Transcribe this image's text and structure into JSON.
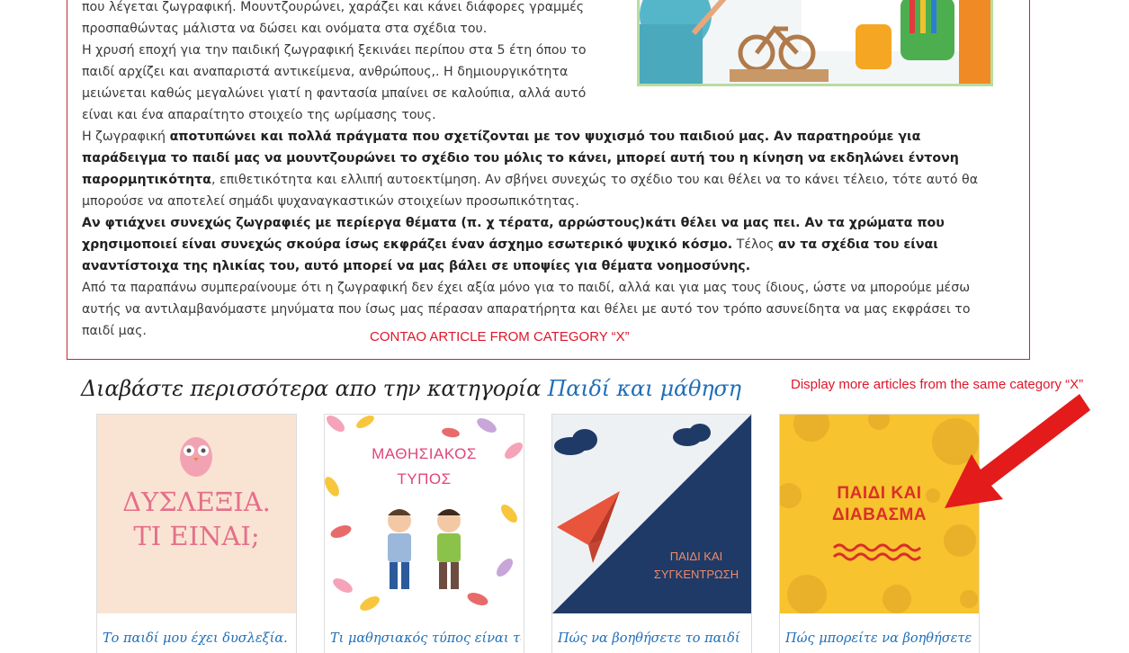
{
  "article": {
    "lines": [
      "που λέγεται ζωγραφική. Μουντζουρώνει, χαράζει και κάνει διάφορες γραμμές",
      "προσπαθώντας μάλιστα να δώσει και ονόματα στα σχέδια του.",
      "Η χρυσή εποχή για την παιδική ζωγραφική ξεκινάει περίπου στα 5 έτη όπου το",
      "παιδί αρχίζει και αναπαριστά αντικείμενα,  ανθρώπους,. Η δημιουργικότητα",
      "μειώνεται καθώς μεγαλώνει γιατί η φαντασία μπαίνει σε καλούπια, αλλά αυτό",
      "είναι και ένα απαραίτητο στοιχείο της ωρίμασης τους."
    ],
    "p2_a": "Η ζωγραφική ",
    "p2_b": "αποτυπώνει και πολλά πράγματα που σχετίζονται με τον ψυχισμό του παιδιού μας.  Αν παρατηρούμε για",
    "p2_c": "παράδειγμα το παιδί μας να μουντζουρώνει το σχέδιο του μόλις το κάνει, μπορεί αυτή του η κίνηση να εκδηλώνει έντονη",
    "p2_d": "παρορμητικότητα",
    "p2_e": ", επιθετικότητα και ελλιπή αυτοεκτίμηση. Αν σβήνει συνεχώς το σχέδιο του και θέλει να το κάνει τέλειο, τότε αυτό θα",
    "p2_f": "μπορούσε να αποτελεί σημάδι ψυχαναγκαστικών στοιχείων προσωπικότητας.",
    "p3_a": "Αν φτιάχνει συνεχώς ζωγραφιές με περίεργα θέματα (π. χ τέρατα, αρρώστους)κάτι θέλει να μας πει. Αν τα χρώματα που",
    "p3_b": "χρησιμοποιεί είναι συνεχώς σκούρα ίσως εκφράζει έναν άσχημο εσωτερικό ψυχικό κόσμο.",
    "p3_c": " Τέλος ",
    "p3_d": "αν τα σχέδια του είναι",
    "p3_e": "αναντίστοιχα της ηλικίας του, αυτό μπορεί να μας βάλει σε υποψίες για θέματα νοημοσύνης.",
    "p4_a": "Από τα παραπάνω συμπεραίνουμε ότι η ζωγραφική δεν έχει αξία μόνο για το παιδί, αλλά και για μας τους ίδιους, ώστε να μπορούμε μέσω",
    "p4_b": "αυτής να αντιλαμβανόμαστε  μηνύματα που ίσως μας πέρασαν απαρατήρητα και θέλει με αυτό τον τρόπο ασυνείδητα να μας εκφράσει το",
    "p4_c": "παιδί  μας."
  },
  "annotations": {
    "article": "CONTAO ARTICLE FROM CATEGORY “X”",
    "more": "Display more articles from the same category “X”"
  },
  "related": {
    "heading_prefix": "Διαβάστε περισσότερα απο την κατηγορία ",
    "category": "Παιδί και μάθηση",
    "cards": [
      {
        "title": "Το παιδί μου έχει δυσλεξία.",
        "thumb_line1": "ΔΥΣΛΕΞΙΑ.",
        "thumb_line2": "ΤΙ ΕΙΝΑΙ;"
      },
      {
        "title": "Τι μαθησιακός τύπος είναι το",
        "thumb_line1": "ΜΑΘΗΣΙΑΚΟΣ",
        "thumb_line2": "ΤΥΠΟΣ"
      },
      {
        "title": "Πώς να βοηθήσετε το παιδί",
        "thumb_line1": "ΠΑΙΔΙ ΚΑΙ",
        "thumb_line2": "ΣΥΓΚΕΝΤΡΩΣΗ"
      },
      {
        "title": "Πώς μπορείτε να βοηθήσετε",
        "thumb_line1": "ΠΑΙΔΙ ΚΑΙ",
        "thumb_line2": "ΔΙΑΒΑΣΜΑ"
      }
    ]
  },
  "colors": {
    "annotation": "#e0152a",
    "link": "#1f6fb8",
    "border": "#c62828"
  }
}
